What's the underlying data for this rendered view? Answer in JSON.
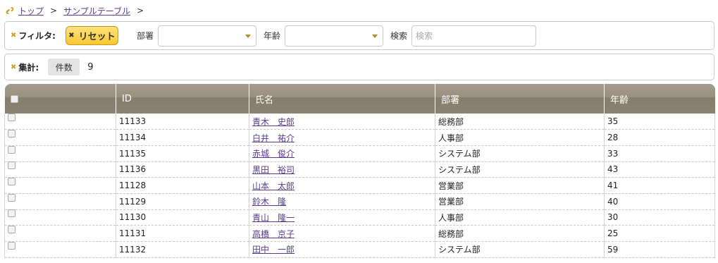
{
  "breadcrumb": {
    "icon": "link-icon",
    "items": [
      "トップ",
      "サンプルテーブル"
    ],
    "separator": ">"
  },
  "filter": {
    "label": "フィルタ:",
    "reset_label": "リセット",
    "dept_label": "部署",
    "dept_value": "",
    "age_label": "年齢",
    "age_value": "",
    "search_label": "検索",
    "search_placeholder": "検索",
    "search_value": ""
  },
  "summary": {
    "label": "集計:",
    "count_label": "件数",
    "count_value": "9"
  },
  "table": {
    "columns": [
      "ID",
      "氏名",
      "部署",
      "年齢"
    ],
    "rows": [
      {
        "id": "11133",
        "name": "青木　史郎",
        "dept": "総務部",
        "age": "35"
      },
      {
        "id": "11134",
        "name": "白井　祐介",
        "dept": "人事部",
        "age": "28"
      },
      {
        "id": "11135",
        "name": "赤城　俊介",
        "dept": "システム部",
        "age": "33"
      },
      {
        "id": "11136",
        "name": "黒田　裕司",
        "dept": "システム部",
        "age": "43"
      },
      {
        "id": "11128",
        "name": "山本　太郎",
        "dept": "営業部",
        "age": "41"
      },
      {
        "id": "11129",
        "name": "鈴木　隆",
        "dept": "営業部",
        "age": "40"
      },
      {
        "id": "11130",
        "name": "青山　隆一",
        "dept": "人事部",
        "age": "30"
      },
      {
        "id": "11131",
        "name": "高橋　京子",
        "dept": "総務部",
        "age": "25"
      },
      {
        "id": "11132",
        "name": "田中　一郎",
        "dept": "システム部",
        "age": "59"
      }
    ]
  },
  "colors": {
    "accent": "#d9a021",
    "link": "#5a3a8c",
    "header_bg": "#8c8271"
  }
}
